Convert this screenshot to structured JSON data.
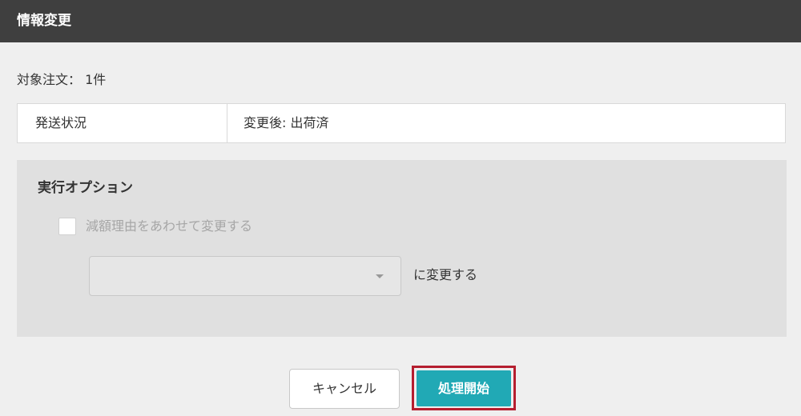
{
  "dialog": {
    "title": "情報変更"
  },
  "target": {
    "label": "対象注文：",
    "count": "1件"
  },
  "summary": {
    "field": "発送状況",
    "change": "変更後:  出荷済"
  },
  "options": {
    "title": "実行オプション",
    "checkbox_label": "減額理由をあわせて変更する",
    "checkbox_checked": false,
    "select_value": "",
    "select_suffix": "に変更する"
  },
  "buttons": {
    "cancel": "キャンセル",
    "start": "処理開始"
  },
  "colors": {
    "header_bg": "#3f3f3f",
    "primary_button": "#21a9b5",
    "highlight_border": "#b51e2f",
    "panel_bg": "#e0e0e0"
  },
  "icons": {
    "select_arrow": "chevron-down-icon"
  }
}
